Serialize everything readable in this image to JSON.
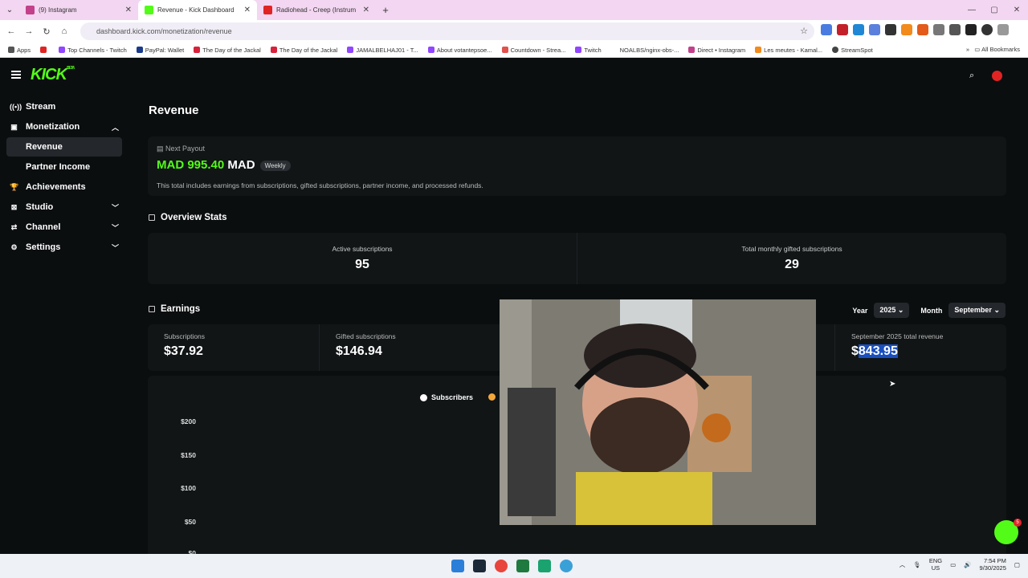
{
  "browser": {
    "tabs": [
      {
        "title": "(9) Instagram",
        "color": "#c2418a"
      },
      {
        "title": "Revenue - Kick Dashboard",
        "color": "#53fc18"
      },
      {
        "title": "Radiohead - Creep (Instrum",
        "color": "#e02424"
      }
    ],
    "url": "dashboard.kick.com/monetization/revenue",
    "bookmarks": [
      "Apps",
      "Top Channels - Twitch",
      "PayPal: Wallet",
      "The Day of the Jackal",
      "The Day of the Jackal",
      "JAMALBELHAJ01 - T...",
      "About votantepsoe...",
      "Countdown - Strea...",
      "Twitch",
      "NOALBS/nginx-obs-...",
      "Direct • Instagram",
      "Les meutes - Kamal...",
      "StreamSpot"
    ],
    "all_bookmarks": "All Bookmarks"
  },
  "kick": {
    "logo": "KICK",
    "beta": "BETA",
    "sidebar": [
      {
        "label": "Stream",
        "icon": "stream-icon"
      },
      {
        "label": "Monetization",
        "icon": "dollar-icon"
      },
      {
        "label": "Revenue"
      },
      {
        "label": "Partner Income"
      },
      {
        "label": "Achievements",
        "icon": "trophy-icon"
      },
      {
        "label": "Studio",
        "icon": "studio-icon"
      },
      {
        "label": "Channel",
        "icon": "channel-icon"
      },
      {
        "label": "Settings",
        "icon": "gear-icon"
      }
    ],
    "page_title": "Revenue",
    "payout": {
      "label": "Next Payout",
      "amount": "MAD 995.40",
      "currency": "MAD",
      "badge": "Weekly",
      "note": "This total includes earnings from subscriptions, gifted subscriptions, partner income, and processed refunds."
    },
    "overview": {
      "title": "Overview Stats",
      "stats": [
        {
          "label": "Active subscriptions",
          "value": "95"
        },
        {
          "label": "Total monthly gifted subscriptions",
          "value": "29"
        }
      ]
    },
    "earnings": {
      "title": "Earnings",
      "year_label": "Year",
      "year_value": "2025",
      "month_label": "Month",
      "month_value": "September",
      "cells": [
        {
          "label": "Subscriptions",
          "value": "$37.92"
        },
        {
          "label": "Gifted subscriptions",
          "value": "$146.94"
        },
        {
          "label": "September 2025 total revenue",
          "value_prefix": "$",
          "value": "843.95"
        }
      ]
    },
    "chart_data": {
      "type": "bar",
      "legend": [
        "Subscribers"
      ],
      "yticks": [
        "$200",
        "$150",
        "$100",
        "$50",
        "$0"
      ],
      "ylim": [
        0,
        200
      ],
      "green_color": "#53fc18",
      "orange_color": "#f5a83a"
    }
  },
  "taskbar": {
    "lang": "ENG",
    "region": "US",
    "time": "7:54 PM",
    "date": "9/30/2025",
    "chat_badge": "5"
  }
}
